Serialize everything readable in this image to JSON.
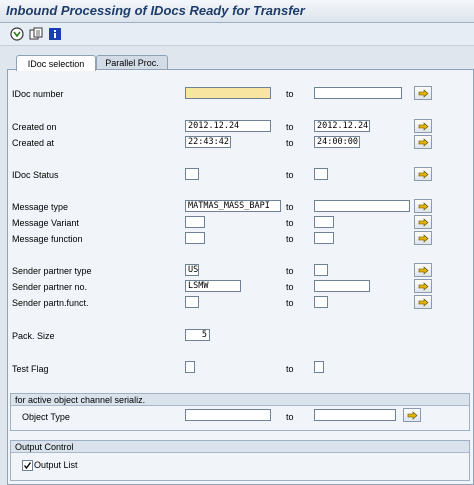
{
  "window": {
    "title": "Inbound Processing of IDocs Ready for Transfer"
  },
  "toolbar": {
    "icons": [
      "execute-icon",
      "variant-icon",
      "info-icon"
    ]
  },
  "tabs": [
    {
      "label": "IDoc selection",
      "active": true
    },
    {
      "label": "Parallel Proc.",
      "active": false
    }
  ],
  "fields": {
    "idoc_number": {
      "label": "IDoc number",
      "from": "",
      "to": ""
    },
    "created_on": {
      "label": "Created on",
      "from": "2012.12.24",
      "to": "2012.12.24"
    },
    "created_at": {
      "label": "Created at",
      "from": "22:43:42",
      "to": "24:00:00"
    },
    "idoc_status": {
      "label": "IDoc Status",
      "from": "",
      "to": ""
    },
    "message_type": {
      "label": "Message type",
      "from": "MATMAS_MASS_BAPI",
      "to": ""
    },
    "message_variant": {
      "label": "Message Variant",
      "from": "",
      "to": ""
    },
    "message_function": {
      "label": "Message function",
      "from": "",
      "to": ""
    },
    "sender_partner_type": {
      "label": "Sender partner type",
      "from": "US",
      "to": ""
    },
    "sender_partner_no": {
      "label": "Sender partner no.",
      "from": "LSMW",
      "to": ""
    },
    "sender_partn_funct": {
      "label": "Sender partn.funct.",
      "from": "",
      "to": ""
    },
    "pack_size": {
      "label": "Pack. Size",
      "value": "5"
    },
    "test_flag": {
      "label": "Test Flag",
      "from": "",
      "to": ""
    }
  },
  "to_label": "to",
  "object_group": {
    "title": "for active object channel serializ.",
    "object_type": {
      "label": "Object Type",
      "from": "",
      "to": ""
    }
  },
  "output_group": {
    "title": "Output Control",
    "output_list": {
      "label": "Output List",
      "checked": true
    }
  },
  "colors": {
    "required_field": "#f8e6a0",
    "title_text": "#1d3c6c",
    "arrow_icon": "#e3b400"
  }
}
